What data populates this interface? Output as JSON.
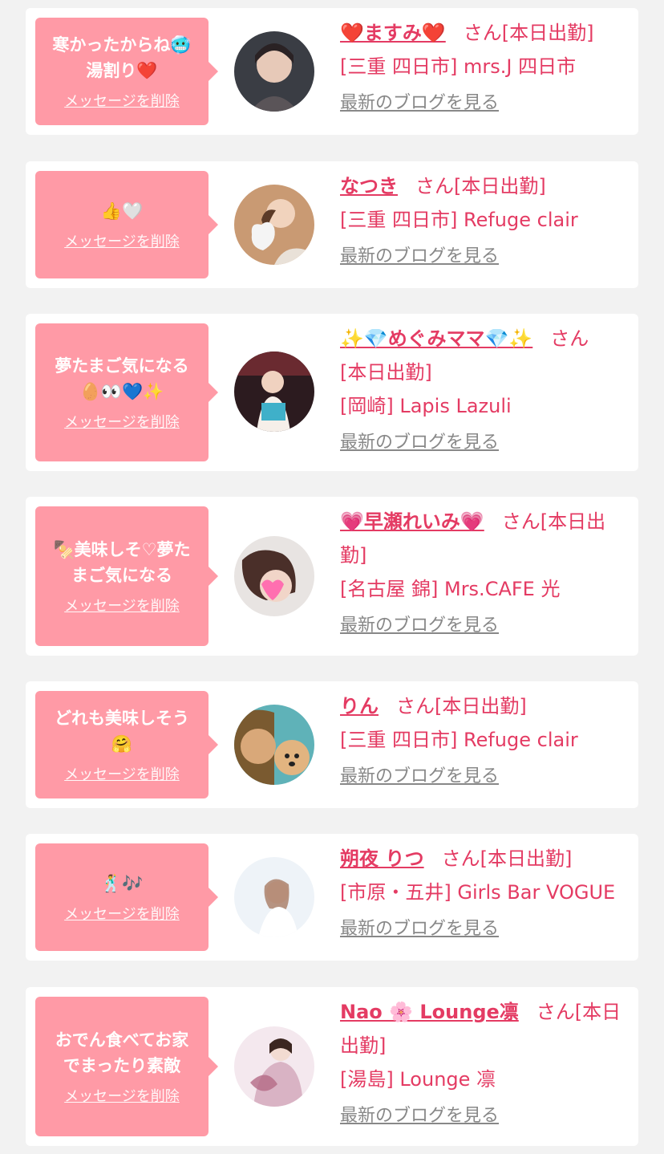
{
  "colors": {
    "accent": "#e43b63",
    "bubble": "#ff9aa6",
    "card": "#ffffff",
    "background": "#f2f2f2",
    "muted": "#888888"
  },
  "labels": {
    "delete": "メッセージを削除",
    "blog": "最新のブログを見る",
    "san": "さん"
  },
  "cards": [
    {
      "message": "寒かったからね🥶\n湯割り❤️",
      "name": "❤️ますみ❤️",
      "status": "[本日出勤]",
      "shop": "[三重 四日市] mrs.J 四日市",
      "avatar": "avatar-photo-icon"
    },
    {
      "message": "👍🤍",
      "name": "なつき",
      "status": "[本日出勤]",
      "shop": "[三重 四日市] Refuge clair",
      "avatar": "avatar-photo-icon"
    },
    {
      "message": "夢たまご気になる\n🥚👀💙✨",
      "name": "✨💎めぐみママ💎✨",
      "status": "[本日出勤]",
      "shop": "[岡崎] Lapis Lazuli",
      "avatar": "avatar-photo-icon"
    },
    {
      "message": "🍢美味しそ♡夢た\nまご気になる",
      "name": "💗早瀬れいみ💗",
      "status": "[本日出勤]",
      "shop": "[名古屋 錦] Mrs.CAFE 光",
      "avatar": "avatar-photo-icon"
    },
    {
      "message": "どれも美味しそう\n🤗",
      "name": "りん",
      "status": "[本日出勤]",
      "shop": "[三重 四日市] Refuge clair",
      "avatar": "avatar-photo-icon"
    },
    {
      "message": "🕺🎶",
      "name": "朔夜 りつ",
      "status": "[本日出勤]",
      "shop": "[市原・五井] Girls Bar VOGUE",
      "avatar": "avatar-photo-icon"
    },
    {
      "message": "おでん食べてお家\nでまったり素敵",
      "name": "Nao 🌸 Lounge凛",
      "status": "[本日出勤]",
      "shop": "[湯島] Lounge 凛",
      "avatar": "avatar-photo-icon"
    }
  ]
}
